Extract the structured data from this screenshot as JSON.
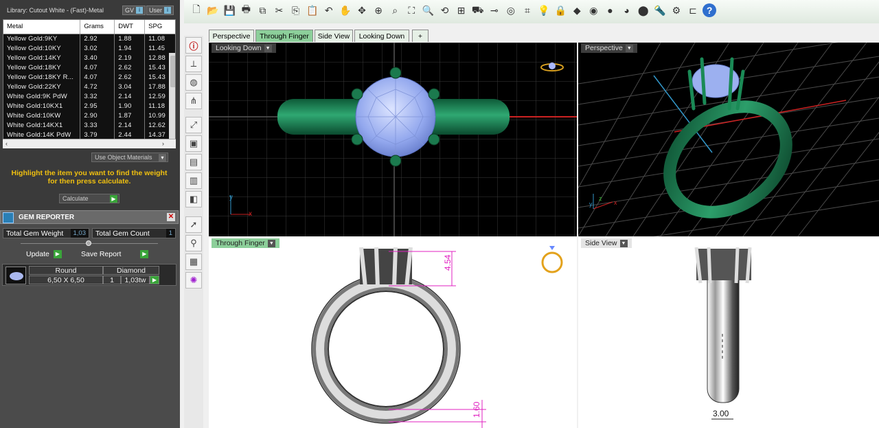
{
  "library": {
    "title": "Library: Cutout White - (Fast)-Metal",
    "btn_gv": "GV",
    "btn_user": "User",
    "columns": [
      "Metal",
      "Grams",
      "DWT",
      "SPG"
    ],
    "rows": [
      [
        "Yellow Gold:9KY",
        "2.92",
        "1.88",
        "11.08"
      ],
      [
        "Yellow Gold:10KY",
        "3.02",
        "1.94",
        "11.45"
      ],
      [
        "Yellow Gold:14KY",
        "3.40",
        "2.19",
        "12.88"
      ],
      [
        "Yellow Gold:18KY",
        "4.07",
        "2.62",
        "15.43"
      ],
      [
        "Yellow Gold:18KY R...",
        "4.07",
        "2.62",
        "15.43"
      ],
      [
        "Yellow Gold:22KY",
        "4.72",
        "3.04",
        "17.88"
      ],
      [
        "White Gold:9K PdW",
        "3.32",
        "2.14",
        "12.59"
      ],
      [
        "White Gold:10KX1",
        "2.95",
        "1.90",
        "11.18"
      ],
      [
        "White Gold:10KW",
        "2.90",
        "1.87",
        "10.99"
      ],
      [
        "White Gold:14KX1",
        "3.33",
        "2.14",
        "12.62"
      ],
      [
        "White Gold:14K PdW",
        "3.79",
        "2.44",
        "14.37"
      ]
    ],
    "use_object_materials": "Use Object Materials",
    "hint": "Highlight the item you want to find the weight for then press calculate.",
    "calculate": "Calculate"
  },
  "gem_reporter": {
    "title": "GEM REPORTER",
    "total_weight_label": "Total Gem Weight",
    "total_weight_value": "1,03",
    "total_count_label": "Total Gem Count",
    "total_count_value": "1",
    "update": "Update",
    "save_report": "Save Report",
    "gem": {
      "shape": "Round",
      "type": "Diamond",
      "size": "6,50 X 6,50",
      "qty": "1",
      "weight": "1,03tw"
    }
  },
  "tabs": [
    "Perspective",
    "Through Finger",
    "Side View",
    "Looking Down"
  ],
  "viewports": {
    "looking_down": "Looking Down",
    "perspective": "Perspective",
    "through_finger": "Through Finger",
    "side_view": "Side View"
  },
  "dimensions": {
    "prong_height": "4.54",
    "shank_height": "1.60",
    "shank_width": "3.00"
  },
  "axes": {
    "x": "x",
    "y": "y",
    "z": "z"
  }
}
